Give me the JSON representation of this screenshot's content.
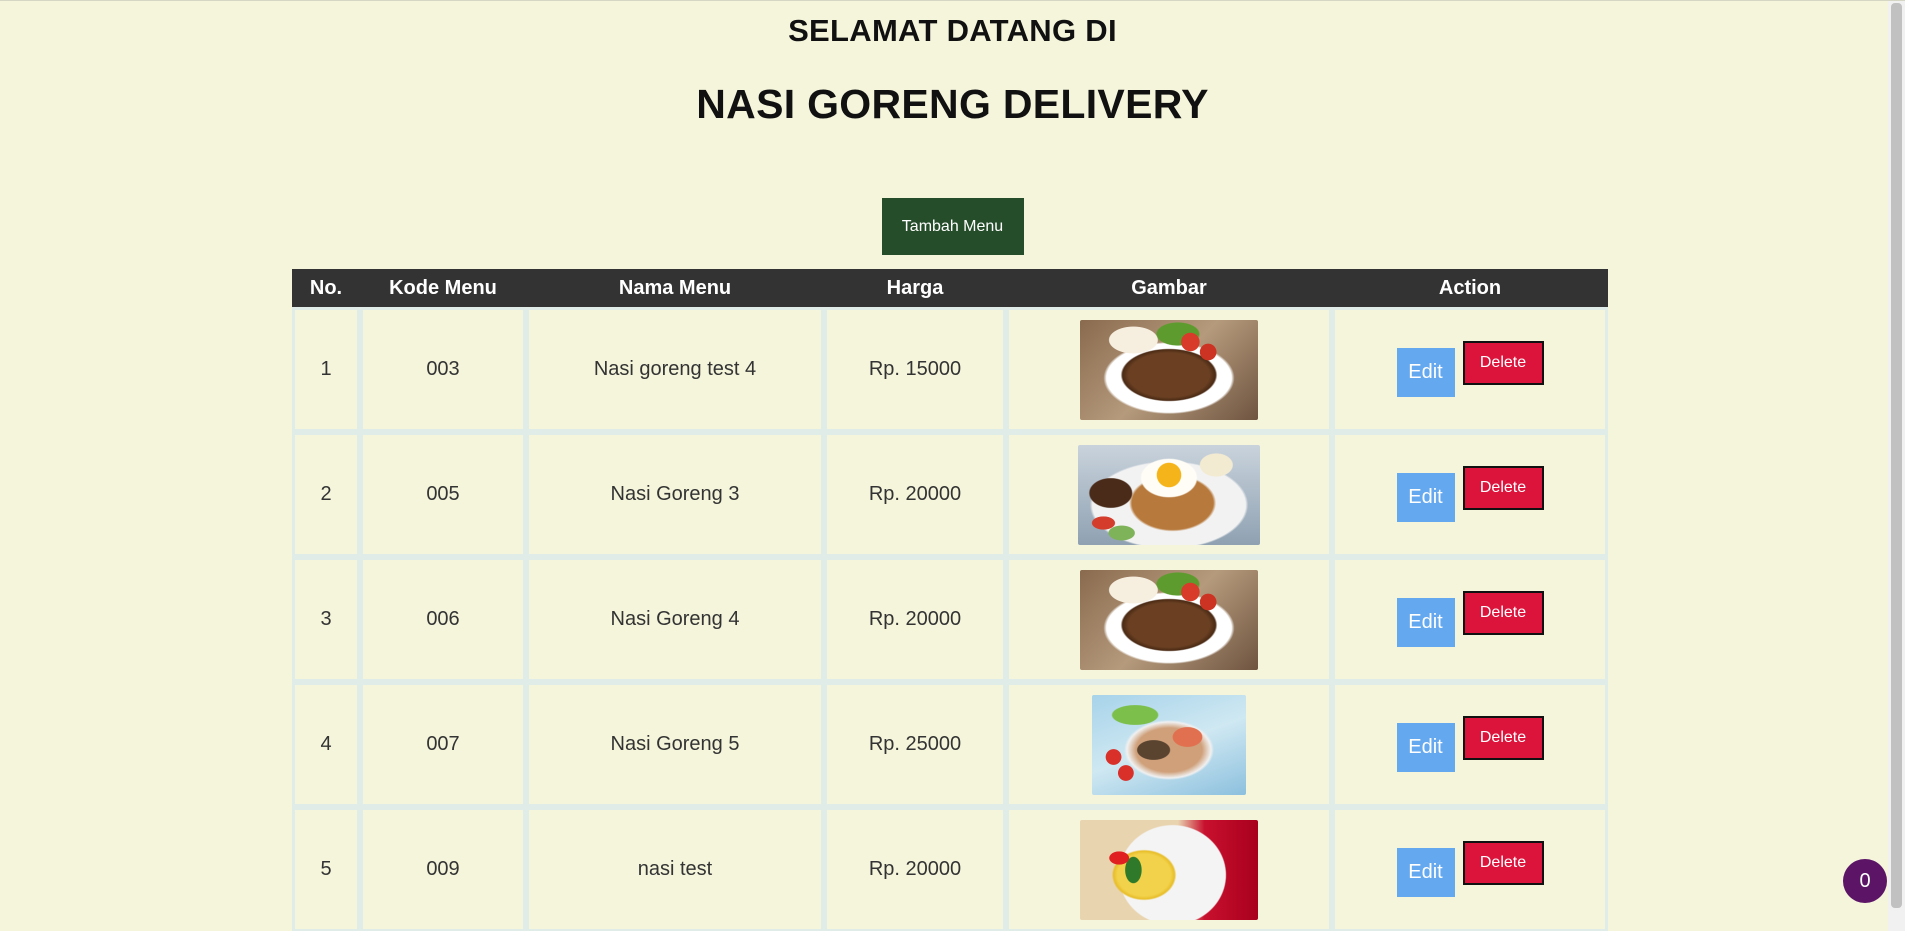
{
  "header": {
    "welcome": "SELAMAT DATANG DI",
    "brand": "NASI GORENG DELIVERY"
  },
  "toolbar": {
    "add_label": "Tambah Menu"
  },
  "table": {
    "columns": [
      "No.",
      "Kode Menu",
      "Nama Menu",
      "Harga",
      "Gambar",
      "Action"
    ],
    "rows": [
      {
        "no": "1",
        "kode": "003",
        "nama": "Nasi goreng test 4",
        "harga": "Rp. 15000",
        "image": "fried-rice-bowl"
      },
      {
        "no": "2",
        "kode": "005",
        "nama": "Nasi Goreng 3",
        "harga": "Rp. 20000",
        "image": "fried-rice-egg"
      },
      {
        "no": "3",
        "kode": "006",
        "nama": "Nasi Goreng 4",
        "harga": "Rp. 20000",
        "image": "fried-rice-bowl"
      },
      {
        "no": "4",
        "kode": "007",
        "nama": "Nasi Goreng 5",
        "harga": "Rp. 25000",
        "image": "seafood-salad"
      },
      {
        "no": "5",
        "kode": "009",
        "nama": "nasi test",
        "harga": "Rp. 20000",
        "image": "omelette-rice"
      }
    ],
    "edit_label": "Edit",
    "delete_label": "Delete"
  },
  "cart": {
    "count": "0"
  },
  "colors": {
    "background": "#f5f5dc",
    "header_bg": "#333333",
    "add_button": "#254d2a",
    "edit_button": "#64a8f0",
    "delete_button": "#dc143c",
    "cart_badge": "#5b1466"
  }
}
